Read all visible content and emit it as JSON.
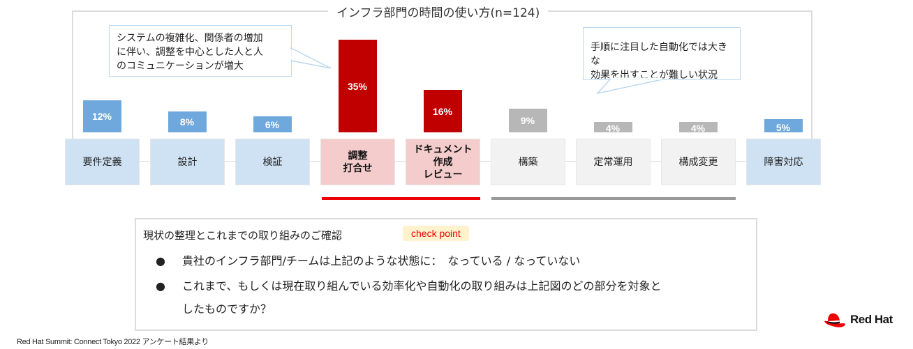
{
  "chart_data": {
    "type": "bar",
    "title": "インフラ部門の時間の使い方(n=124)",
    "categories": [
      "要件定義",
      "設計",
      "検証",
      "調整\n打合せ",
      "ドキュメント\n作成\nレビュー",
      "構築",
      "定常運用",
      "構成変更",
      "障害対応"
    ],
    "values": [
      12,
      8,
      6,
      35,
      16,
      9,
      4,
      4,
      5
    ],
    "data_labels": [
      "12%",
      "8%",
      "6%",
      "35%",
      "16%",
      "9%",
      "4%",
      "4%",
      "5%"
    ],
    "unit": "%",
    "groups": [
      "design",
      "design",
      "design",
      "communication",
      "communication",
      "operations",
      "operations",
      "operations",
      "design"
    ],
    "group_colors": {
      "design": {
        "bar": "#6fa8dc",
        "box": "#cfe2f3",
        "text": "#222222"
      },
      "communication": {
        "bar": "#c00000",
        "box": "#f4cccc",
        "text": "#111111"
      },
      "operations": {
        "bar": "#b7b7b7",
        "box": "#f2f2f2",
        "text": "#222222"
      }
    },
    "xlabel": "",
    "ylabel": "",
    "ylim": [
      0,
      35
    ],
    "grid": false,
    "legend": "none",
    "annotations": [
      {
        "id": "left",
        "text": "システムの複雑化、関係者の増加に伴い、調整を中心とした人と人のコミュニケーションが増大",
        "target": "調整\n打合せ"
      },
      {
        "id": "right",
        "text": "手順に注目した自動化では大きな効果を出すことが難しい状況",
        "target": "構築"
      }
    ],
    "highlights": [
      {
        "range": [
          "調整\n打合せ",
          "ドキュメント\n作成\nレビュー"
        ],
        "color": "#ee0000"
      },
      {
        "range": [
          "構築",
          "構成変更"
        ],
        "color": "#999999"
      }
    ]
  },
  "callouts": {
    "left_lines": [
      "システムの複雑化、関係者の増加",
      "に伴い、調整を中心とした人と人",
      "のコミュニケーションが増大"
    ],
    "right_lines": [
      "手順に注目した自動化では大きな",
      "効果を出すことが難しい状況"
    ]
  },
  "checkpoint": {
    "heading": "現状の整理とこれまでの取り組みのご確認",
    "badge": "check point",
    "bullet": "●",
    "items": [
      "貴社のインフラ部門/チームは上記のような状態に：　なっている / なっていない",
      "これまで、もしくは現在取り組んでいる効率化や自動化の取り組みは上記図のどの部分を対象と",
      "したものですか？"
    ]
  },
  "footnote": "Red Hat Summit: Connect Tokyo 2022 アンケート結果より",
  "logo": {
    "text": "Red Hat",
    "icon": "red-hat-fedora-icon"
  }
}
